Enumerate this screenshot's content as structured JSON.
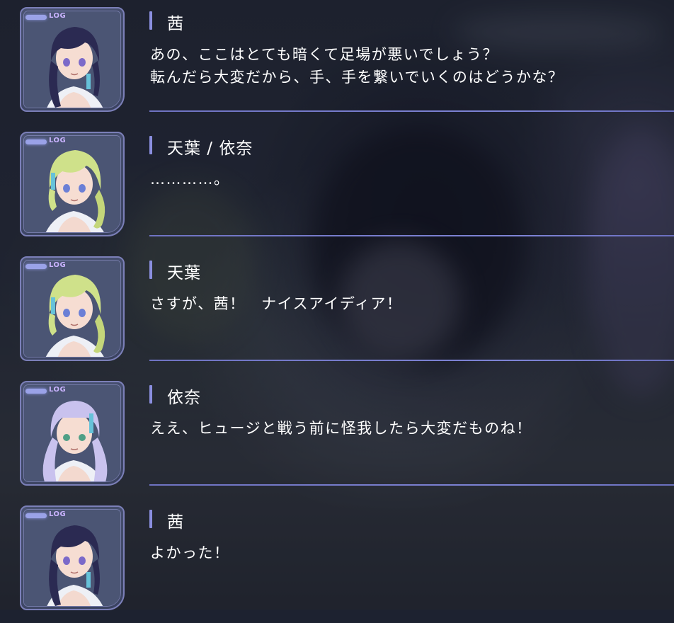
{
  "badge_text": "LOG",
  "entries": [
    {
      "speaker": "茜",
      "lines": [
        "あの、ここはとても暗くて足場が悪いでしょう？",
        "転んだら大変だから、手、手を繋いでいくのはどうかな？"
      ],
      "portrait": "character-akane-portrait",
      "hair": "#2b2a52"
    },
    {
      "speaker": "天葉 / 依奈",
      "lines": [
        "…………。"
      ],
      "portrait": "character-amaha-portrait",
      "hair": "#cfe18a"
    },
    {
      "speaker": "天葉",
      "lines": [
        "さすが、茜！　ナイスアイディア！"
      ],
      "portrait": "character-amaha-portrait",
      "hair": "#cfe18a"
    },
    {
      "speaker": "依奈",
      "lines": [
        "ええ、ヒュージと戦う前に怪我したら大変だものね！"
      ],
      "portrait": "character-ena-portrait",
      "hair": "#c9c2ee"
    },
    {
      "speaker": "茜",
      "lines": [
        "よかった！"
      ],
      "portrait": "character-akane-portrait",
      "hair": "#2b2a52"
    }
  ],
  "colors": {
    "accent": "#8b8fe0",
    "divider": "#7e84d6",
    "frame": "#7b7fb8",
    "text": "#ffffff"
  }
}
